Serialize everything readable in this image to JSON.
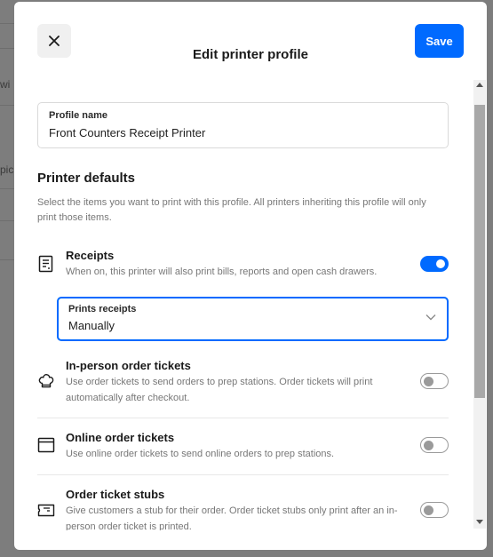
{
  "background": {
    "fragments": [
      "wi",
      "pic"
    ]
  },
  "header": {
    "title": "Edit printer profile",
    "save_label": "Save",
    "close_icon": "close-icon"
  },
  "profile_name": {
    "label": "Profile name",
    "value": "Front Counters Receipt Printer"
  },
  "defaults": {
    "title": "Printer defaults",
    "description": "Select the items you want to print with this profile. All printers inheriting this profile will only print those items."
  },
  "items": [
    {
      "icon": "receipt-icon",
      "title": "Receipts",
      "description": "When on, this printer will also print bills, reports and open cash drawers.",
      "enabled": true
    },
    {
      "icon": "chef-hat-icon",
      "title": "In-person order tickets",
      "description": "Use order tickets to send orders to prep stations. Order tickets will print automatically after checkout.",
      "enabled": false
    },
    {
      "icon": "browser-window-icon",
      "title": "Online order tickets",
      "description": "Use online order tickets to send online orders to prep stations.",
      "enabled": false
    },
    {
      "icon": "ticket-stub-icon",
      "title": "Order ticket stubs",
      "description": "Give customers a stub for their order. Order ticket stubs only print after an in-person order ticket is printed.",
      "enabled": false
    }
  ],
  "prints_receipts": {
    "label": "Prints receipts",
    "value": "Manually"
  },
  "colors": {
    "accent": "#006aff",
    "overlay": "#7d7d7d"
  }
}
